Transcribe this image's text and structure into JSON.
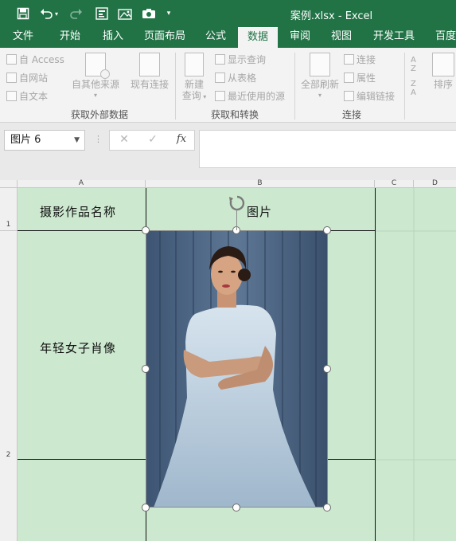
{
  "window": {
    "title": "案例.xlsx - Excel"
  },
  "qat": {
    "save": "save-icon",
    "undo": "undo-icon",
    "redo": "redo-icon",
    "form": "form-icon",
    "camera": "camera-icon",
    "more": "▾"
  },
  "tabs": [
    "文件",
    "开始",
    "插入",
    "页面布局",
    "公式",
    "数据",
    "审阅",
    "视图",
    "开发工具",
    "百度"
  ],
  "ribbon": {
    "external": {
      "access": "自 Access",
      "web": "自网站",
      "text": "自文本",
      "other": "自其他来源",
      "existing": "现有连接",
      "label": "获取外部数据"
    },
    "transform": {
      "new_query_1": "新建",
      "new_query_2": "查询",
      "show_queries": "显示查询",
      "from_table": "从表格",
      "recent_sources": "最近使用的源",
      "label": "获取和转换"
    },
    "connections": {
      "refresh_all": "全部刷新",
      "connections": "连接",
      "properties": "属性",
      "edit_links": "编辑链接",
      "label": "连接"
    },
    "sort": {
      "sort": "排序"
    }
  },
  "formula_bar": {
    "name_box": "图片 6",
    "cancel": "✕",
    "enter": "✓",
    "fx": "fx",
    "formula": ""
  },
  "columns": [
    "A",
    "B",
    "C",
    "D"
  ],
  "rows": [
    "1",
    "2"
  ],
  "cells": {
    "A1": "摄影作品名称",
    "B1": "图片",
    "A2": "年轻女子肖像"
  },
  "colors": {
    "accent": "#217346",
    "cell_fill": "#cce8cf"
  },
  "picture": {
    "name": "图片 6"
  }
}
